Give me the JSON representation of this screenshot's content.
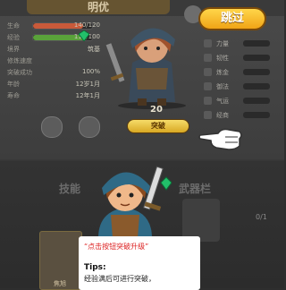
{
  "header": {
    "character_name": "明优"
  },
  "stats": [
    {
      "label": "生命",
      "value": "140/120",
      "fill": 0.85,
      "color": "#c95a3a"
    },
    {
      "label": "经验",
      "value": "110/100",
      "fill": 0.9,
      "color": "#5aa23a"
    },
    {
      "label": "境界",
      "value": "筑基",
      "fill": 0.0,
      "color": "#888888"
    },
    {
      "label": "修炼速度",
      "value": "",
      "fill": 0.0,
      "color": "#888888"
    },
    {
      "label": "突破成功",
      "value": "100%",
      "fill": 0.0,
      "color": "#888888"
    },
    {
      "label": "年龄",
      "value": "12岁1月",
      "fill": 0.0,
      "color": "#888888"
    },
    {
      "label": "寿命",
      "value": "12年1月",
      "fill": 0.0,
      "color": "#888888"
    }
  ],
  "hero": {
    "level": "20"
  },
  "breakthrough": {
    "label": "突破"
  },
  "skip": {
    "label": "跳过"
  },
  "attributes": [
    {
      "name": "力量"
    },
    {
      "name": "韧性"
    },
    {
      "name": "炼金"
    },
    {
      "name": "御法"
    },
    {
      "name": "气运"
    },
    {
      "name": "经商"
    }
  ],
  "sections": {
    "skills": "技能",
    "weapons": "武器栏",
    "slot_count": "0/1"
  },
  "card": {
    "label": "焦旭"
  },
  "dialog": {
    "quote": "“点击按钮突破升级”",
    "tips": "Tips:",
    "body": "经验满后可进行突破，"
  },
  "colors": {
    "skip_button": "#f5b820",
    "breakthrough_button": "#e8c040",
    "gem": "#22c06a"
  }
}
